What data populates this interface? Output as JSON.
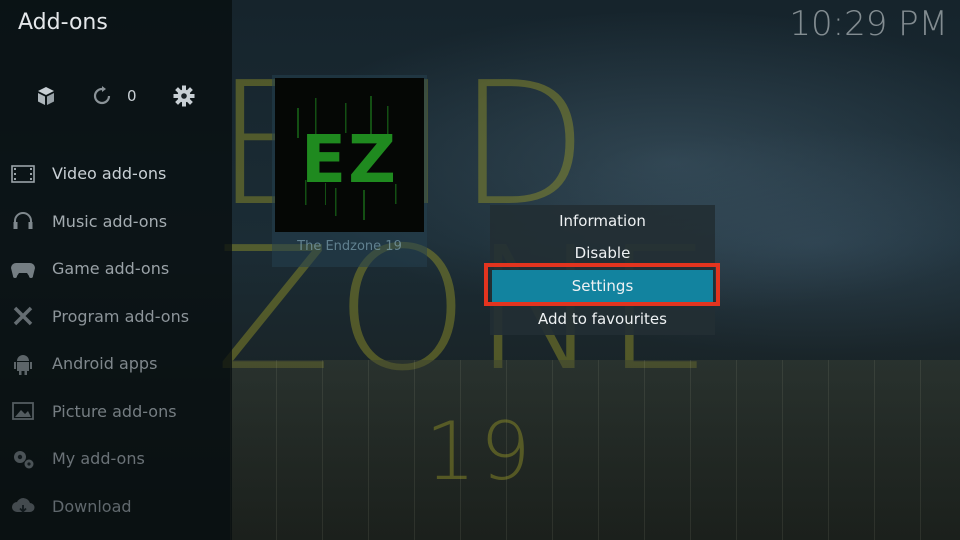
{
  "header": {
    "title": "Add-ons",
    "clock": "10:29 PM"
  },
  "toolbar": {
    "update_count": "0"
  },
  "sidebar": {
    "items": [
      {
        "label": "Video add-ons",
        "icon": "film-icon"
      },
      {
        "label": "Music add-ons",
        "icon": "headphones-icon"
      },
      {
        "label": "Game add-ons",
        "icon": "gamepad-icon"
      },
      {
        "label": "Program add-ons",
        "icon": "tools-icon"
      },
      {
        "label": "Android apps",
        "icon": "android-icon"
      },
      {
        "label": "Picture add-ons",
        "icon": "picture-icon"
      },
      {
        "label": "My add-ons",
        "icon": "gears-icon"
      },
      {
        "label": "Download",
        "icon": "cloud-download-icon"
      }
    ]
  },
  "addon": {
    "name": "The Endzone 19",
    "logo_text": "EZ"
  },
  "background": {
    "line1": "END",
    "line2": "ZONE",
    "line3": "19"
  },
  "context_menu": {
    "items": [
      "Information",
      "Disable",
      "Settings",
      "Add to favourites"
    ],
    "selected": "Settings"
  },
  "colors": {
    "accent": "#12839f",
    "highlight": "#e3341f",
    "logo_green": "#1f8a1f"
  }
}
